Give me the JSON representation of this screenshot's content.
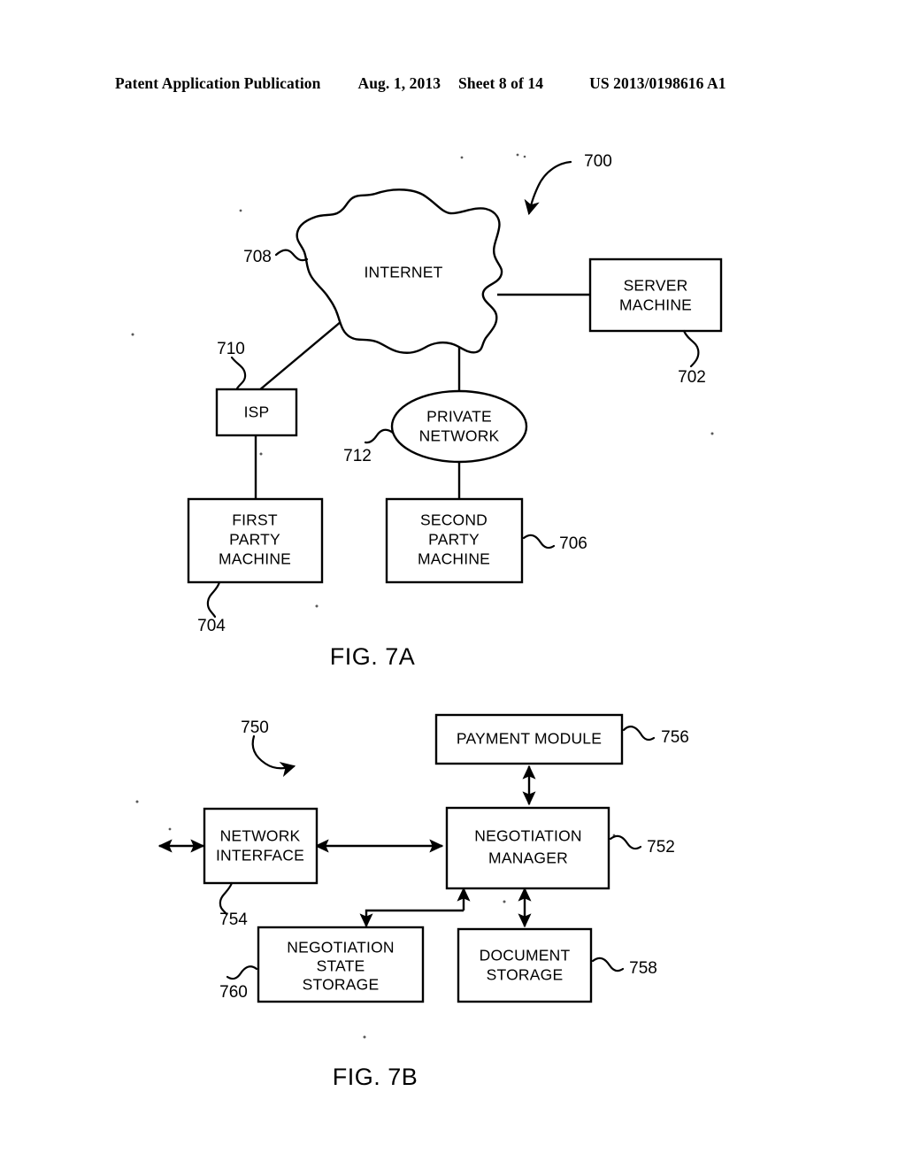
{
  "header": {
    "publication": "Patent Application Publication",
    "date": "Aug. 1, 2013",
    "sheet": "Sheet 8 of 14",
    "patent_number": "US 2013/0198616 A1"
  },
  "figures": [
    {
      "id": "fig-7a",
      "caption": "FIG. 7A",
      "overall_ref": "700",
      "nodes": [
        {
          "key": "internet",
          "label": "INTERNET",
          "ref": "708",
          "shape": "cloud"
        },
        {
          "key": "server",
          "label_line1": "SERVER",
          "label_line2": "MACHINE",
          "ref": "702",
          "shape": "rect"
        },
        {
          "key": "isp",
          "label": "ISP",
          "ref": "710",
          "shape": "rect"
        },
        {
          "key": "private",
          "label_line1": "PRIVATE",
          "label_line2": "NETWORK",
          "ref": "712",
          "shape": "ellipse"
        },
        {
          "key": "first_party",
          "label_line1": "FIRST",
          "label_line2": "PARTY",
          "label_line3": "MACHINE",
          "ref": "704",
          "shape": "rect"
        },
        {
          "key": "second_party",
          "label_line1": "SECOND",
          "label_line2": "PARTY",
          "label_line3": "MACHINE",
          "ref": "706",
          "shape": "rect"
        }
      ],
      "connections": [
        {
          "from": "internet",
          "to": "server"
        },
        {
          "from": "internet",
          "to": "isp"
        },
        {
          "from": "internet",
          "to": "private"
        },
        {
          "from": "isp",
          "to": "first_party"
        },
        {
          "from": "private",
          "to": "second_party"
        }
      ]
    },
    {
      "id": "fig-7b",
      "caption": "FIG. 7B",
      "overall_ref": "750",
      "nodes": [
        {
          "key": "payment",
          "label": "PAYMENT MODULE",
          "ref": "756",
          "shape": "rect"
        },
        {
          "key": "net_iface",
          "label_line1": "NETWORK",
          "label_line2": "INTERFACE",
          "ref": "754",
          "shape": "rect"
        },
        {
          "key": "neg_manager",
          "label_line1": "NEGOTIATION",
          "label_line2": "MANAGER",
          "ref": "752",
          "shape": "rect"
        },
        {
          "key": "neg_state",
          "label_line1": "NEGOTIATION",
          "label_line2": "STATE",
          "label_line3": "STORAGE",
          "ref": "760",
          "shape": "rect"
        },
        {
          "key": "doc_storage",
          "label_line1": "DOCUMENT",
          "label_line2": "STORAGE",
          "ref": "758",
          "shape": "rect"
        }
      ],
      "connections": [
        {
          "from": "neg_manager",
          "to": "payment",
          "arrow": "double"
        },
        {
          "from": "net_iface",
          "to": "neg_manager",
          "arrow": "double"
        },
        {
          "from": "external",
          "to": "net_iface",
          "arrow": "double"
        },
        {
          "from": "neg_manager",
          "to": "neg_state",
          "arrow": "elbow"
        },
        {
          "from": "neg_manager",
          "to": "doc_storage",
          "arrow": "double"
        }
      ]
    }
  ]
}
